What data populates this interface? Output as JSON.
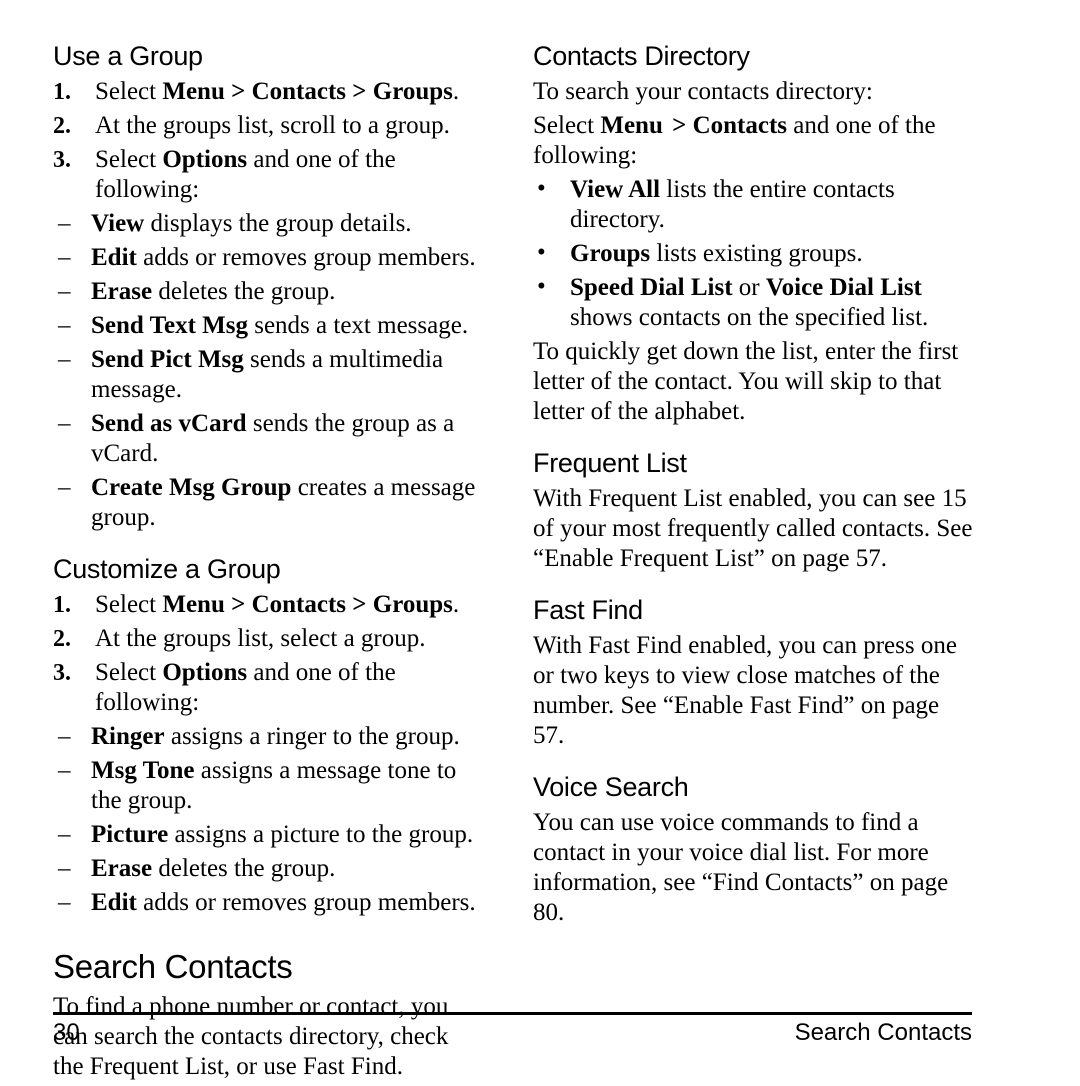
{
  "page": {
    "number": "30",
    "footer_title": "Search Contacts"
  },
  "left_column": {
    "use_a_group": {
      "heading": "Use a Group",
      "steps": [
        {
          "num": "1.",
          "pre": "Select ",
          "bold": "Menu > Contacts > Groups",
          "post": "."
        },
        {
          "num": "2.",
          "pre": "At the groups list, scroll to a group.",
          "bold": "",
          "post": ""
        },
        {
          "num": "3.",
          "pre": "Select ",
          "bold": "Options",
          "post": " and one of the following:"
        }
      ],
      "options": [
        {
          "dash": "–",
          "bold": "View",
          "rest": " displays the group details."
        },
        {
          "dash": "–",
          "bold": "Edit",
          "rest": " adds or removes group members."
        },
        {
          "dash": "–",
          "bold": "Erase",
          "rest": " deletes the group."
        },
        {
          "dash": "–",
          "bold": "Send Text Msg",
          "rest": " sends a text message."
        },
        {
          "dash": "–",
          "bold": "Send Pict Msg",
          "rest": " sends a multimedia message."
        },
        {
          "dash": "–",
          "bold": "Send as vCard",
          "rest": " sends the group as a vCard."
        },
        {
          "dash": "–",
          "bold": "Create Msg Group",
          "rest": " creates a message group."
        }
      ]
    },
    "customize_a_group": {
      "heading": "Customize a Group",
      "steps": [
        {
          "num": "1.",
          "pre": "Select ",
          "bold": "Menu > Contacts > Groups",
          "post": "."
        },
        {
          "num": "2.",
          "pre": "At the groups list, select a group.",
          "bold": "",
          "post": ""
        },
        {
          "num": "3.",
          "pre": "Select ",
          "bold": "Options",
          "post": " and one of the following:"
        }
      ],
      "options": [
        {
          "dash": "–",
          "bold": "Ringer",
          "rest": " assigns a ringer to the group."
        },
        {
          "dash": "–",
          "bold": "Msg Tone",
          "rest": " assigns a message tone to the group."
        },
        {
          "dash": "–",
          "bold": "Picture",
          "rest": " assigns a picture to the group."
        },
        {
          "dash": "–",
          "bold": "Erase",
          "rest": " deletes the group."
        },
        {
          "dash": "–",
          "bold": "Edit",
          "rest": " adds or removes group members."
        }
      ]
    },
    "search_contacts": {
      "heading": "Search Contacts",
      "paragraph": "To find a phone number or contact, you can search the contacts directory, check the Frequent List, or use Fast Find."
    }
  },
  "right_column": {
    "contacts_directory": {
      "heading": "Contacts Directory",
      "intro": "To search your contacts directory:",
      "select_pre": "Select ",
      "select_bold_1": "Menu",
      "select_gap": " ",
      "select_bold_2": "> Contacts",
      "select_post": " and one of the following:",
      "bullets": [
        {
          "bullet": "•",
          "bold": "View All",
          "rest": " lists the entire contacts directory."
        },
        {
          "bullet": "•",
          "bold": "Groups",
          "rest": " lists existing groups."
        },
        {
          "bullet": "•",
          "bold_a": "Speed Dial List",
          "mid": " or ",
          "bold_b": "Voice Dial List",
          "rest": " shows contacts on the specified list."
        }
      ],
      "closing": "To quickly get down the list, enter the first letter of the contact. You will skip to that letter of the alphabet."
    },
    "frequent_list": {
      "heading": "Frequent List",
      "paragraph": "With Frequent List enabled, you can see 15 of your most frequently called contacts. See “Enable Frequent List” on page 57."
    },
    "fast_find": {
      "heading": "Fast Find",
      "paragraph": "With Fast Find enabled, you can press one or two keys to view close matches of the number. See “Enable Fast Find” on page 57."
    },
    "voice_search": {
      "heading": "Voice Search",
      "paragraph": "You can use voice commands to find a contact in your voice dial list. For more information, see “Find Contacts” on page 80."
    }
  }
}
